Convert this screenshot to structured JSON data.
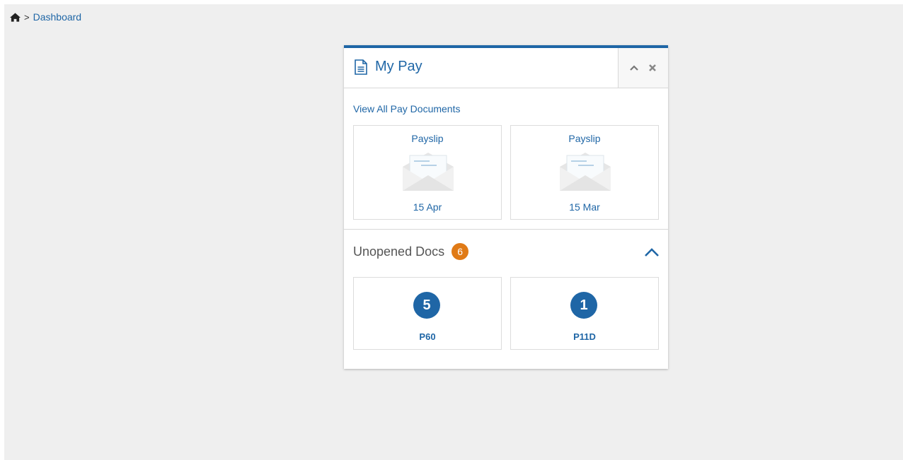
{
  "breadcrumb": {
    "home_icon": "home-icon",
    "separator": ">",
    "current": "Dashboard"
  },
  "widget": {
    "title": "My Pay",
    "title_icon": "document-icon",
    "controls": {
      "collapse_icon": "chevron-up-icon",
      "close_icon": "close-icon"
    },
    "view_all_label": "View All Pay Documents",
    "documents": [
      {
        "type": "Payslip",
        "date": "15 Apr",
        "icon": "envelope-open-icon"
      },
      {
        "type": "Payslip",
        "date": "15 Mar",
        "icon": "envelope-open-icon"
      }
    ],
    "unopened": {
      "title": "Unopened Docs",
      "total": "6",
      "toggle_icon": "chevron-up-icon",
      "items": [
        {
          "count": "5",
          "name": "P60"
        },
        {
          "count": "1",
          "name": "P11D"
        }
      ]
    }
  },
  "colors": {
    "accent": "#1f66a6",
    "badge": "#e07a16",
    "background": "#efefef"
  }
}
